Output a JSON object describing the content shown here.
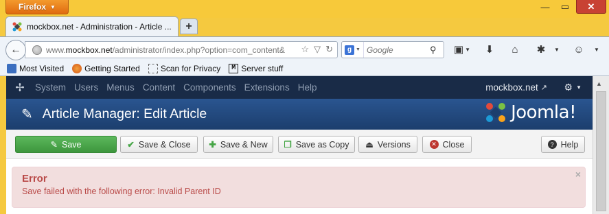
{
  "browser": {
    "menu_label": "Firefox",
    "tab_title": "mockbox.net - Administration - Article ...",
    "url_prefix": "www.",
    "url_domain": "mockbox.net",
    "url_path": "/administrator/index.php?option=com_content&",
    "search_placeholder": "Google",
    "bookmarks": [
      "Most Visited",
      "Getting Started",
      "Scan for Privacy",
      "Server stuff"
    ]
  },
  "joomla": {
    "menu": [
      "System",
      "Users",
      "Menus",
      "Content",
      "Components",
      "Extensions",
      "Help"
    ],
    "site_name": "mockbox.net",
    "page_title": "Article Manager: Edit Article",
    "brand": "Joomla!",
    "toolbar": {
      "save": "Save",
      "save_close": "Save & Close",
      "save_new": "Save & New",
      "save_copy": "Save as Copy",
      "versions": "Versions",
      "close": "Close",
      "help": "Help"
    },
    "alert": {
      "heading": "Error",
      "message": "Save failed with the following error: Invalid Parent ID"
    }
  },
  "colors": {
    "joomla_nav": "#192b47",
    "joomla_header": "#1c3e6d",
    "save_green": "#46a546",
    "error_text": "#b94a48",
    "error_bg": "#f2dede"
  }
}
